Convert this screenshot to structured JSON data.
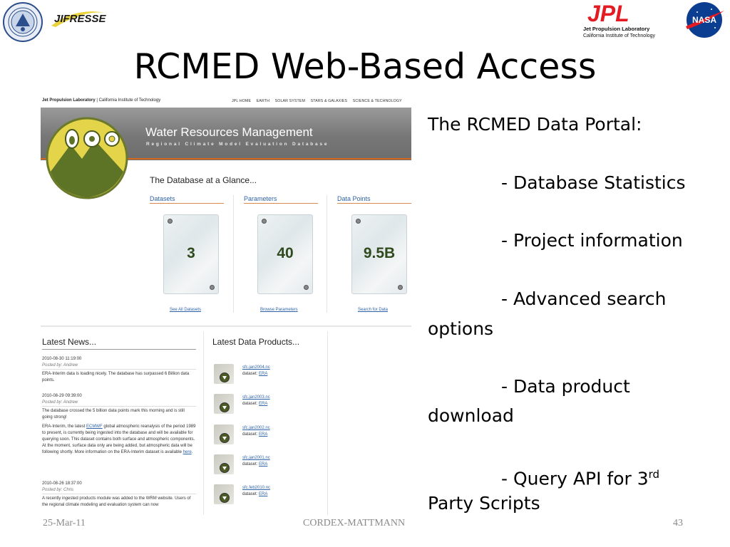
{
  "slide": {
    "title": "RCMED Web-Based Access",
    "footer": {
      "date": "25-Mar-11",
      "presenter": "CORDEX-MATTMANN",
      "page": "43"
    }
  },
  "logos": {
    "jifresse_text": "JIFRESSE",
    "jpl_mark": "JPL",
    "jpl_line1": "Jet Propulsion Laboratory",
    "jpl_line2": "California Institute of Technology",
    "nasa_text": "NASA",
    "jpl_color": "#e31b23",
    "nasa_blue": "#0b3d91"
  },
  "website": {
    "org_bold": "Jet Propulsion Laboratory",
    "org_rest": "| California Institute of Technology",
    "nav": [
      "JPL HOME",
      "EARTH",
      "SOLAR SYSTEM",
      "STARS & GALAXIES",
      "SCIENCE & TECHNOLOGY"
    ],
    "banner_title": "Water Resources Management",
    "banner_subtitle": "Regional Climate Model Evaluation Database",
    "glance_title": "The Database at a Glance...",
    "stats": [
      {
        "label": "Datasets",
        "value": "3",
        "link": "See All Datasets"
      },
      {
        "label": "Parameters",
        "value": "40",
        "link": "Browse Parameters"
      },
      {
        "label": "Data Points",
        "value": "9.5B",
        "link": "Search for Data"
      }
    ],
    "news_title": "Latest News...",
    "news": [
      {
        "date": "2010-08-30 11:19:00",
        "poster": "Posted by: Andrew",
        "body": "ERA-Interim data is loading nicely. The database has surpassed 6 Billion data points."
      },
      {
        "date": "2010-08-29 09:39:00",
        "poster": "Posted by: Andrew",
        "body1": "The database crossed the 5 billion data points mark this morning and is still going strong!",
        "body2_pre": "ERA-Interim, the latest ",
        "body2_link": "ECMWF",
        "body2_mid": " global atmospheric reanalysis of the period 1989 to present, is currently being ingested into the database and will be available for querying soon. This dataset contains both surface and atmospheric components. At the moment, surface data only are being added, but atmospheric data will be following shortly. More information on the ERA-Interim dataset is available ",
        "body2_link2": "here",
        "body2_end": "."
      },
      {
        "date": "2010-08-26 18:37:00",
        "poster": "Posted by: Chris",
        "body": "A recently ingested products module was added to the WRM website. Users of the regional climate modeling and evaluation system can now"
      }
    ],
    "products_title": "Latest Data Products...",
    "products": [
      {
        "name": "sfc.jan2004.nc",
        "dataset_label": "dataset:",
        "dataset": "ERA"
      },
      {
        "name": "sfc.jan2003.nc",
        "dataset_label": "dataset:",
        "dataset": "ERA"
      },
      {
        "name": "sfc.jan2002.nc",
        "dataset_label": "dataset:",
        "dataset": "ERA"
      },
      {
        "name": "sfc.jan2001.nc",
        "dataset_label": "dataset:",
        "dataset": "ERA"
      },
      {
        "name": "sfc.feb2010.nc",
        "dataset_label": "dataset:",
        "dataset": "ERA"
      }
    ]
  },
  "portal_text": {
    "heading": "The RCMED Data Portal:",
    "item1": "- Database Statistics",
    "item2": "- Project information",
    "item3a": "- Advanced search",
    "item3b": "options",
    "item4a": "- Data product",
    "item4b": "download",
    "item5a": "- Query API for 3",
    "item5sup": "rd",
    "item5b": "Party Scripts"
  }
}
